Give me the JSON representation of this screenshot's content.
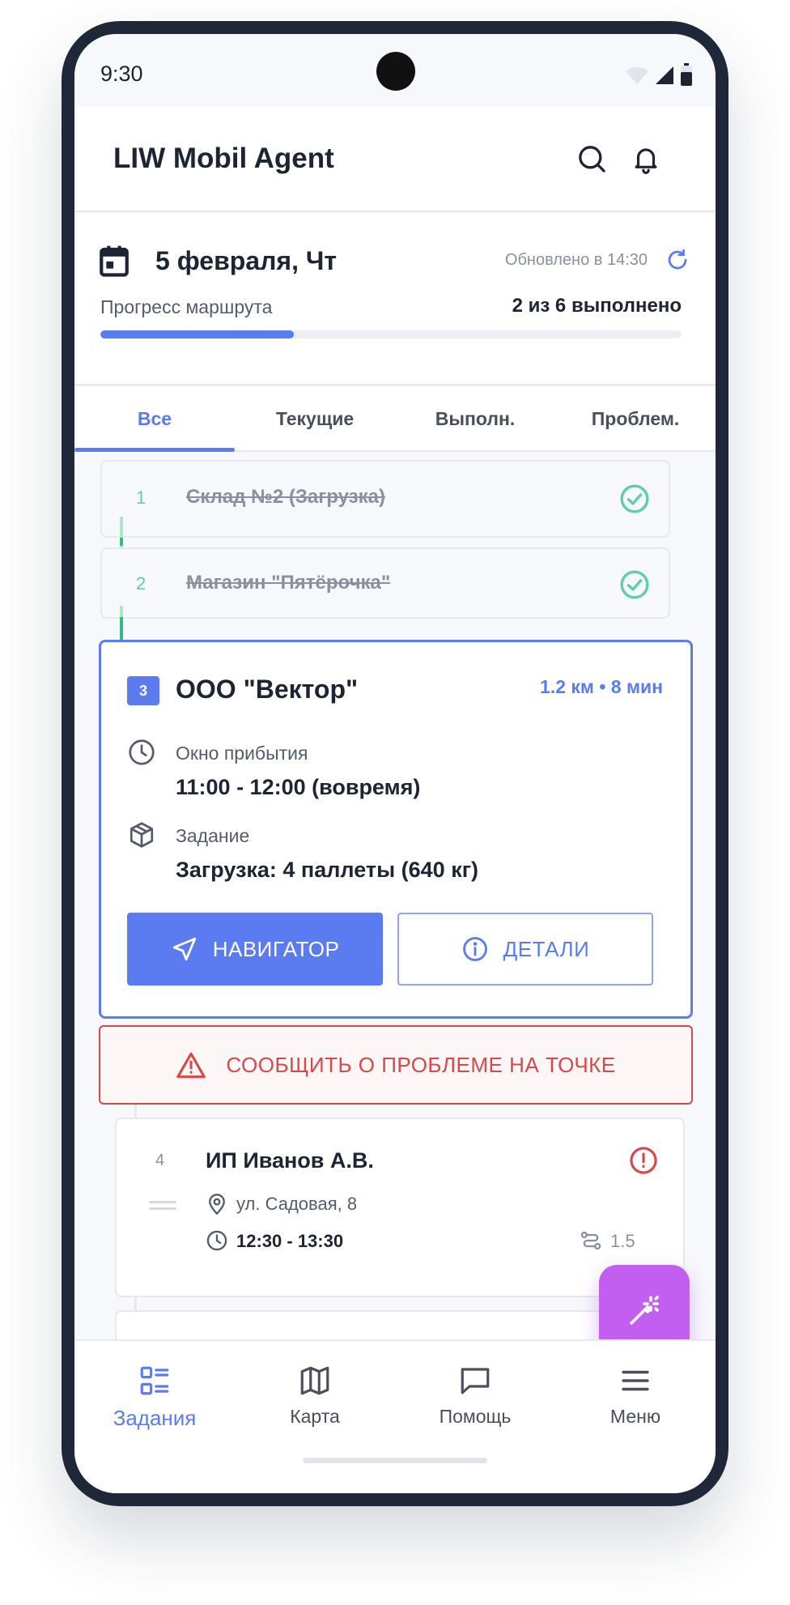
{
  "status_bar": {
    "time": "9:30"
  },
  "app_bar": {
    "title": "LIW Mobil Agent"
  },
  "day_header": {
    "date": "5 февраля, Чт",
    "updated": "Обновлено в 14:30",
    "progress_label": "Прогресс маршрута",
    "progress_count": "2 из 6 выполнено",
    "progress_fraction": 0.333
  },
  "tabs": [
    {
      "label": "Все",
      "active": true
    },
    {
      "label": "Текущие",
      "active": false
    },
    {
      "label": "Выполн.",
      "active": false
    },
    {
      "label": "Проблем.",
      "active": false
    }
  ],
  "completed_stops": [
    {
      "number": "1",
      "name": "Склад №2 (Загрузка)"
    },
    {
      "number": "2",
      "name": "Магазин \"Пятёрочка\""
    }
  ],
  "current_stop": {
    "number": "3",
    "name": "ООО \"Вектор\"",
    "eta": "1.2 км • 8 мин",
    "arrival_label": "Окно прибытия",
    "arrival_value": "11:00 - 12:00 (вовремя)",
    "task_label": "Задание",
    "task_value": "Загрузка: 4 паллеты (640 кг)",
    "navigator_label": "НАВИГАТОР",
    "details_label": "ДЕТАЛИ"
  },
  "report_problem_label": "СООБЩИТЬ О ПРОБЛЕМЕ НА ТОЧКЕ",
  "next_stop": {
    "number": "4",
    "name": "ИП Иванов А.В.",
    "address": "ул. Садовая, 8",
    "time": "12:30 - 13:30",
    "distance": "1.5"
  },
  "bottom_nav": [
    {
      "label": "Задания",
      "icon": "tasks-icon",
      "active": true
    },
    {
      "label": "Карта",
      "icon": "map-icon",
      "active": false
    },
    {
      "label": "Помощь",
      "icon": "chat-icon",
      "active": false
    },
    {
      "label": "Меню",
      "icon": "menu-icon",
      "active": false
    }
  ],
  "colors": {
    "accent": "#5b7cf0",
    "success": "#2cbf7f",
    "danger": "#d94848",
    "fab": "#c25ff0"
  }
}
